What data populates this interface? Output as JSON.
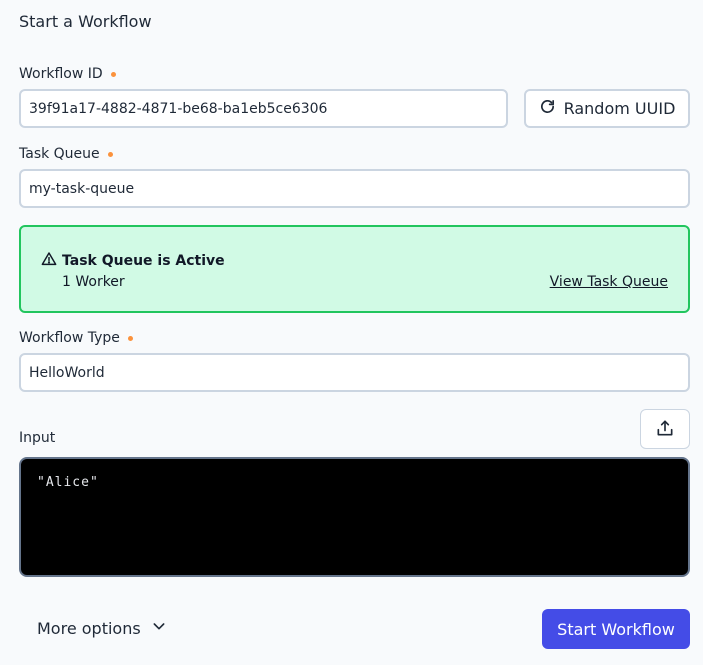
{
  "page": {
    "title": "Start a Workflow"
  },
  "workflow_id": {
    "label": "Workflow ID",
    "value": "39f91a17-4882-4871-be68-ba1eb5ce6306",
    "random_button_label": "Random UUID"
  },
  "task_queue": {
    "label": "Task Queue",
    "value": "my-task-queue"
  },
  "alert": {
    "title": "Task Queue is Active",
    "workers": "1 Worker",
    "link_label": "View Task Queue"
  },
  "workflow_type": {
    "label": "Workflow Type",
    "value": "HelloWorld"
  },
  "input": {
    "label": "Input",
    "code": "\"Alice\""
  },
  "footer": {
    "more_options_label": "More options",
    "start_button_label": "Start Workflow"
  },
  "colors": {
    "required_dot": "#fb923c",
    "alert_bg": "#d1fae5",
    "alert_border": "#22c55e",
    "primary": "#444ce7",
    "editor_bg": "#000000"
  },
  "icons": [
    "refresh-icon",
    "warning-icon",
    "upload-icon",
    "chevron-down-icon"
  ]
}
